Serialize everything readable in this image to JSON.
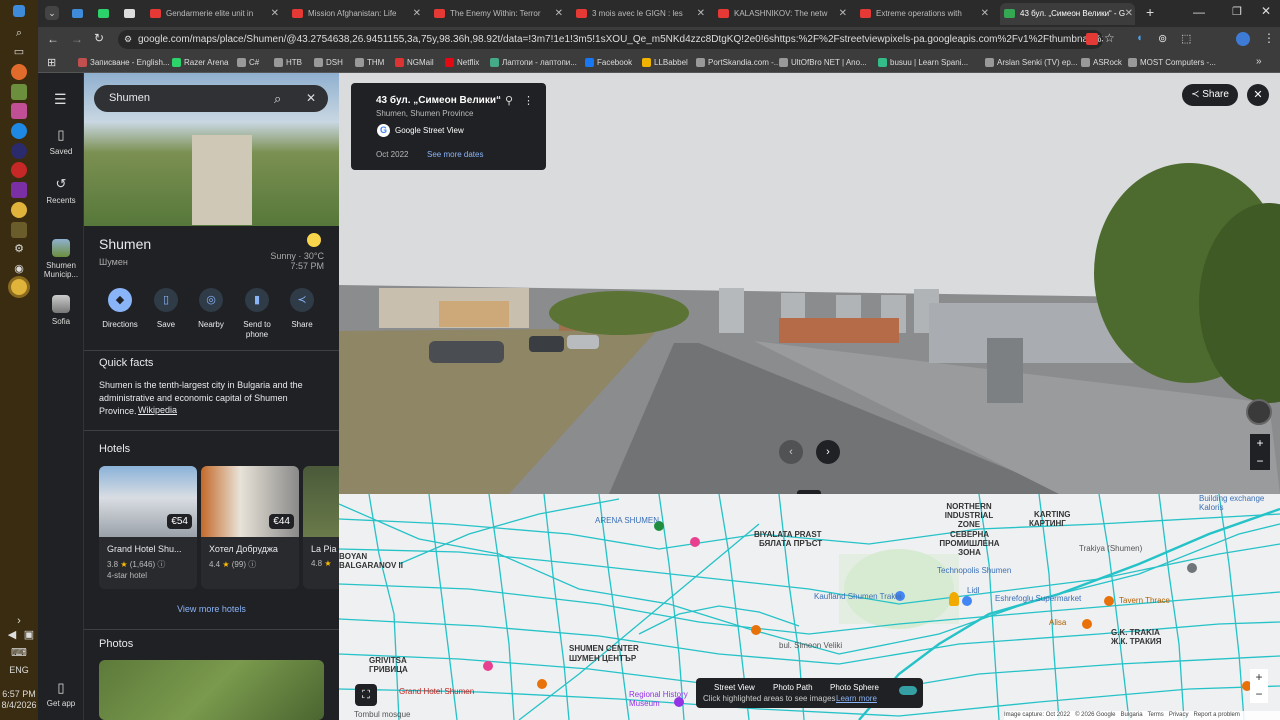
{
  "taskbar": {
    "time": "6:57 PM",
    "date": "8/4/2026",
    "lang": "ENG"
  },
  "tabs": [
    {
      "title": "Gendarmerie elite unit in"
    },
    {
      "title": "Mission Afghanistan: Life"
    },
    {
      "title": "The Enemy Within: Terror"
    },
    {
      "title": "3 mois avec le GIGN : les"
    },
    {
      "title": "KALASHNIKOV: The netw"
    },
    {
      "title": "Extreme operations with"
    },
    {
      "title": "43 бул. „Симеон Велики“ - G"
    }
  ],
  "url": "google.com/maps/place/Shumen/@43.2754638,26.9451155,3a,75y,98.36h,98.92t/data=!3m7!1e1!3m5!1sXOU_Qe_m5NKd4zzc8DtgKQ!2e0!6shttps:%2F%2Fstreetviewpixels-pa.googleapis.com%2Fv1%2Fthumbnail%3Fcb_client%3Dmaps_sv.tacti...",
  "bookmarks": [
    "Записване - English...",
    "Razer Arena",
    "C#",
    "HTB",
    "DSH",
    "THM",
    "NGMail",
    "Netflix",
    "Лаптопи - лаптопи...",
    "Facebook",
    "LLBabbel",
    "PortSkandia.com -...",
    "UltOfBro NET | Ano...",
    "busuu | Learn Spani...",
    "Arslan Senki (TV) ep...",
    "ASRock",
    "MOST Computers -..."
  ],
  "rail": {
    "saved": "Saved",
    "recents": "Recents",
    "recent1": "Shumen Municip...",
    "recent2": "Sofia",
    "get_app": "Get app"
  },
  "panel": {
    "search_value": "Shumen",
    "place_name": "Shumen",
    "place_alt": "Шумен",
    "weather": "Sunny · 30°C",
    "weather_time": "7:57 PM",
    "actions": [
      "Directions",
      "Save",
      "Nearby",
      "Send to phone",
      "Share"
    ],
    "quick_facts_title": "Quick facts",
    "quick_facts_text": "Shumen is the tenth-largest city in Bulgaria and the administrative and economic capital of Shumen Province.",
    "wikipedia": "Wikipedia",
    "hotels_title": "Hotels",
    "hotels": [
      {
        "name": "Grand Hotel Shu...",
        "price": "€54",
        "rating": "3.8",
        "reviews": "(1,646)",
        "type": "4-star hotel"
      },
      {
        "name": "Хотел Добруджа",
        "price": "€44",
        "rating": "4.4",
        "reviews": "(99)",
        "type": ""
      },
      {
        "name": "La Pia",
        "price": "",
        "rating": "4.8",
        "reviews": "",
        "type": ""
      }
    ],
    "view_more": "View more hotels",
    "photos_title": "Photos"
  },
  "streetview": {
    "address": "43 бул. „Симеон Велики“",
    "locality": "Shumen, Shumen Province",
    "source": "Google Street View",
    "date": "Oct 2022",
    "see_more": "See more dates",
    "share": "Share"
  },
  "map": {
    "labels": [
      "ARENA SHUMEN",
      "BIYALATA PRAST",
      "БЯЛАТА ПРЪСТ",
      "NORTHERN INDUSTRIAL ZONE",
      "СЕВЕРНА ПРОМИШЛЕНА ЗОНА",
      "KARTING",
      "КАРТИНГ",
      "Technopolis Shumen",
      "Kaufland Shumen Trakia",
      "Lidl",
      "Eshrefoglu Supermarket",
      "Tavern Thrace",
      "Alisa",
      "G.K. TRAKIA",
      "Ж.К. ТРАКИЯ",
      "SHUMEN CENTER",
      "ШУМЕН ЦЕНТЪР",
      "GRIVITSA",
      "ГРИВИЦА",
      "Grand Hotel Shumen",
      "Regional History Museum",
      "Tombul mosque",
      "BOYAN BALGARANOV II",
      "Trakiya (Shumen)",
      "Building exchange Kaloris",
      "bul. Simeon Veliki",
      "Kaufland Shumen Trakia",
      "Tsar Boris III"
    ],
    "layers": {
      "street_view": "Street View",
      "photo_path": "Photo Path",
      "photo_sphere": "Photo Sphere",
      "hint": "Click highlighted areas to see images",
      "learn_more": "Learn more"
    },
    "footer": [
      "Image capture: Oct 2022",
      "© 2026 Google",
      "Bulgaria",
      "Terms",
      "Privacy",
      "Report a problem"
    ]
  }
}
